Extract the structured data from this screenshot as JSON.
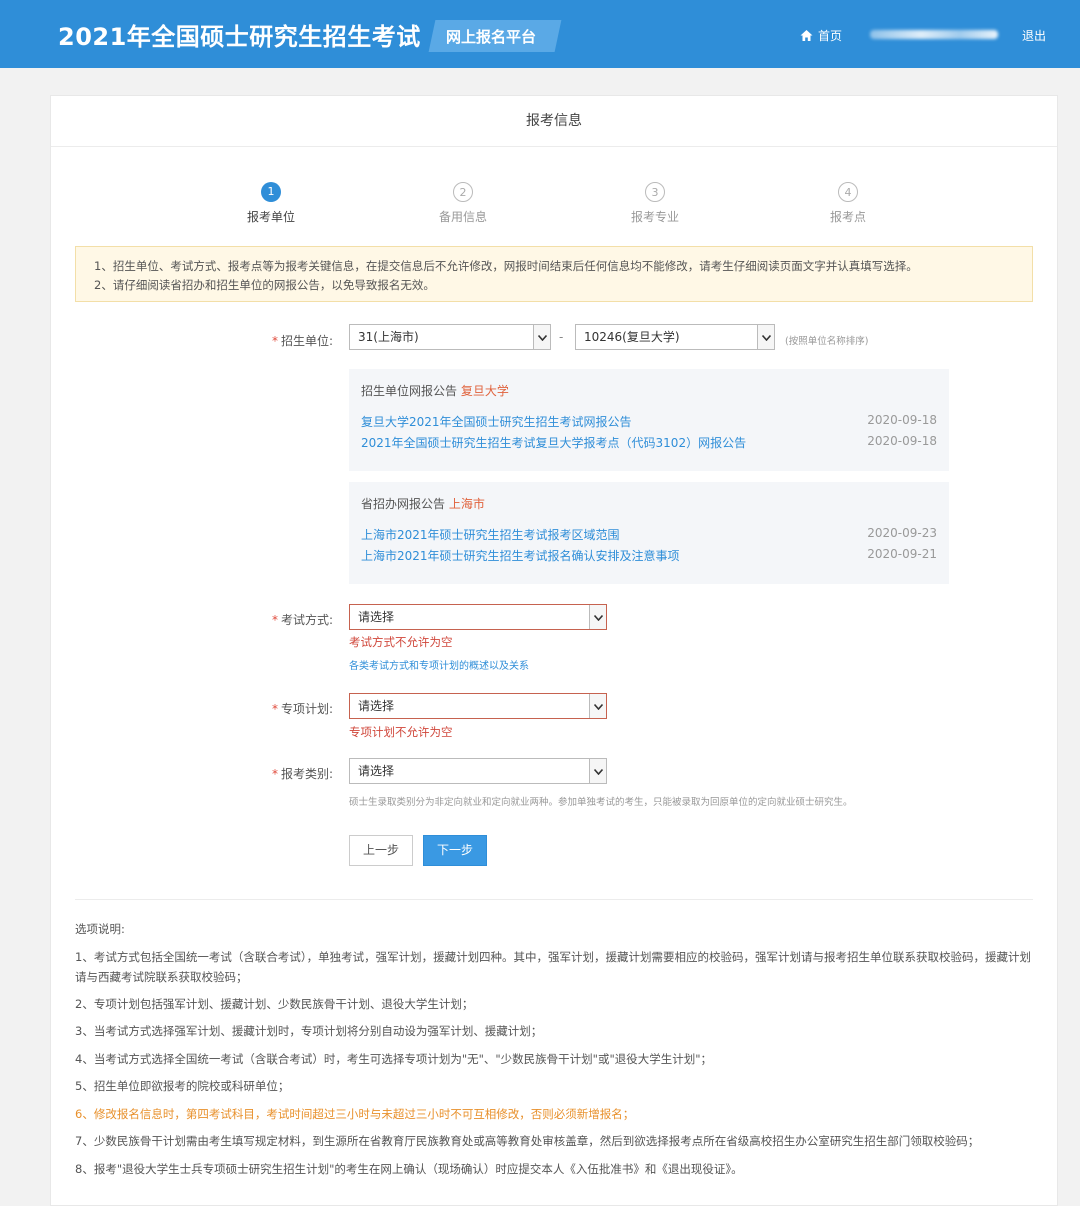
{
  "header": {
    "brand": "2021年全国硕士研究生招生考试",
    "platform": "网上报名平台",
    "home_label": "首页",
    "logout_label": "退出"
  },
  "card": {
    "title": "报考信息"
  },
  "steps": [
    {
      "num": "1",
      "label": "报考单位"
    },
    {
      "num": "2",
      "label": "备用信息"
    },
    {
      "num": "3",
      "label": "报考专业"
    },
    {
      "num": "4",
      "label": "报考点"
    }
  ],
  "notice": {
    "line1": "1、招生单位、考试方式、报考点等为报考关键信息，在提交信息后不允许修改，网报时间结束后任何信息均不能修改，请考生仔细阅读页面文字并认真填写选择。",
    "line2": "2、请仔细阅读省招办和招生单位的网报公告，以免导致报名无效。"
  },
  "form": {
    "unit_label": "招生单位:",
    "unit_province": "31(上海市)",
    "unit_school": "10246(复旦大学)",
    "unit_hint": "(按照单位名称排序)",
    "exam_mode_label": "考试方式:",
    "exam_mode_value": "请选择",
    "exam_mode_error": "考试方式不允许为空",
    "exam_mode_link": "各类考试方式和专项计划的概述以及关系",
    "plan_label": "专项计划:",
    "plan_value": "请选择",
    "plan_error": "专项计划不允许为空",
    "category_label": "报考类别:",
    "category_value": "请选择",
    "category_hint": "硕士生录取类别分为非定向就业和定向就业两种。参加单独考试的考生，只能被录取为回原单位的定向就业硕士研究生。",
    "prev_label": "上一步",
    "next_label": "下一步"
  },
  "school_announcements": {
    "title": "招生单位网报公告",
    "highlight": "复旦大学",
    "items": [
      {
        "title": "复旦大学2021年全国硕士研究生招生考试网报公告",
        "date": "2020-09-18"
      },
      {
        "title": "2021年全国硕士研究生招生考试复旦大学报考点（代码3102）网报公告",
        "date": "2020-09-18"
      }
    ]
  },
  "province_announcements": {
    "title": "省招办网报公告",
    "highlight": "上海市",
    "items": [
      {
        "title": "上海市2021年硕士研究生招生考试报考区域范围",
        "date": "2020-09-23"
      },
      {
        "title": "上海市2021年硕士研究生招生考试报名确认安排及注意事项",
        "date": "2020-09-21"
      }
    ]
  },
  "notes": {
    "title": "选项说明:",
    "n1": "1、考试方式包括全国统一考试（含联合考试），单独考试，强军计划，援藏计划四种。其中，强军计划，援藏计划需要相应的校验码，强军计划请与报考招生单位联系获取校验码，援藏计划请与西藏考试院联系获取校验码；",
    "n2": "2、专项计划包括强军计划、援藏计划、少数民族骨干计划、退役大学生计划；",
    "n3": "3、当考试方式选择强军计划、援藏计划时，专项计划将分别自动设为强军计划、援藏计划；",
    "n4": "4、当考试方式选择全国统一考试（含联合考试）时，考生可选择专项计划为\"无\"、\"少数民族骨干计划\"或\"退役大学生计划\"；",
    "n5": "5、招生单位即欲报考的院校或科研单位；",
    "n6": "6、修改报名信息时，第四考试科目，考试时间超过三小时与未超过三小时不可互相修改，否则必须新增报名；",
    "n7": "7、少数民族骨干计划需由考生填写规定材料，到生源所在省教育厅民族教育处或高等教育处审核盖章，然后到欲选择报考点所在省级高校招生办公室研究生招生部门领取校验码；",
    "n8": "8、报考\"退役大学生士兵专项硕士研究生招生计划\"的考生在网上确认（现场确认）时应提交本人《入伍批准书》和《退出现役证》。"
  }
}
